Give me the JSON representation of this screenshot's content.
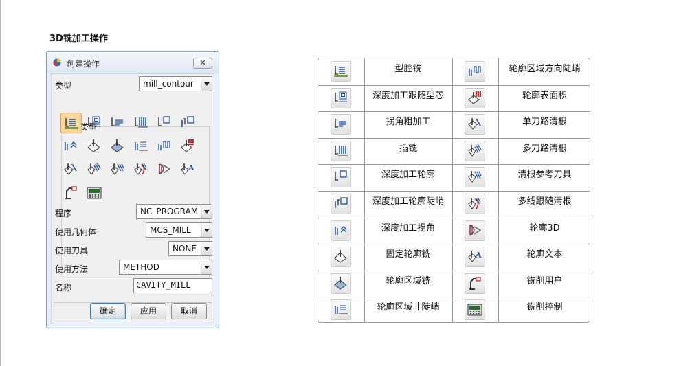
{
  "page": {
    "heading": "3D铣加工操作"
  },
  "dialog": {
    "title": "创建操作",
    "close_glyph": "✕",
    "type_label": "类型",
    "type_value": "mill_contour",
    "subtype_label": "子类型",
    "subtype_icons": [
      "cavity-mill-icon",
      "zlevel-follow-core-icon",
      "corner-rough-icon",
      "plunge-mill-icon",
      "zlevel-profile-icon",
      "zlevel-profile-steep-icon",
      "zlevel-corner-icon",
      "fixed-contour-icon",
      "contour-area-icon",
      "contour-area-non-steep-icon",
      "contour-area-dir-steep-icon",
      "contour-surface-area-icon",
      "flowcut-single-icon",
      "flowcut-multiple-icon",
      "flowcut-ref-tool-icon",
      "flowcut-smooth-icon",
      "profile-3d-icon",
      "contour-text-icon",
      "mill-user-icon",
      "mill-control-icon"
    ],
    "selected_subtype": 0,
    "program_label": "程序",
    "program_value": "NC_PROGRAM",
    "geometry_label": "使用几何体",
    "geometry_value": "MCS_MILL",
    "tool_label": "使用刀具",
    "tool_value": "NONE",
    "method_label": "使用方法",
    "method_value": "METHOD",
    "name_label": "名称",
    "name_value": "CAVITY_MILL",
    "ok_label": "确定",
    "apply_label": "应用",
    "cancel_label": "取消"
  },
  "operations_table": {
    "left": [
      {
        "icon": "cavity-mill-icon",
        "label": "型腔铣"
      },
      {
        "icon": "zlevel-follow-core-icon",
        "label": "深度加工跟随型芯"
      },
      {
        "icon": "corner-rough-icon",
        "label": "拐角粗加工"
      },
      {
        "icon": "plunge-mill-icon",
        "label": "插铣"
      },
      {
        "icon": "zlevel-profile-icon",
        "label": "深度加工轮廓"
      },
      {
        "icon": "zlevel-profile-steep-icon",
        "label": "深度加工轮廓陡峭"
      },
      {
        "icon": "zlevel-corner-icon",
        "label": "深度加工拐角"
      },
      {
        "icon": "fixed-contour-icon",
        "label": "固定轮廓铣"
      },
      {
        "icon": "contour-area-icon",
        "label": "轮廓区域铣"
      },
      {
        "icon": "contour-area-non-steep-icon",
        "label": "轮廓区域非陡峭"
      }
    ],
    "right": [
      {
        "icon": "contour-area-dir-steep-icon",
        "label": "轮廓区域方向陡峭"
      },
      {
        "icon": "contour-surface-area-icon",
        "label": "轮廓表面积"
      },
      {
        "icon": "flowcut-single-icon",
        "label": "单刀路清根"
      },
      {
        "icon": "flowcut-multiple-icon",
        "label": "多刀路清根"
      },
      {
        "icon": "flowcut-ref-tool-icon",
        "label": "清根参考刀具"
      },
      {
        "icon": "flowcut-smooth-icon",
        "label": "多线跟随清根"
      },
      {
        "icon": "profile-3d-icon",
        "label": "轮廓3D"
      },
      {
        "icon": "contour-text-icon",
        "label": "轮廓文本"
      },
      {
        "icon": "mill-user-icon",
        "label": "铣削用户"
      },
      {
        "icon": "mill-control-icon",
        "label": "铣削控制"
      }
    ]
  }
}
